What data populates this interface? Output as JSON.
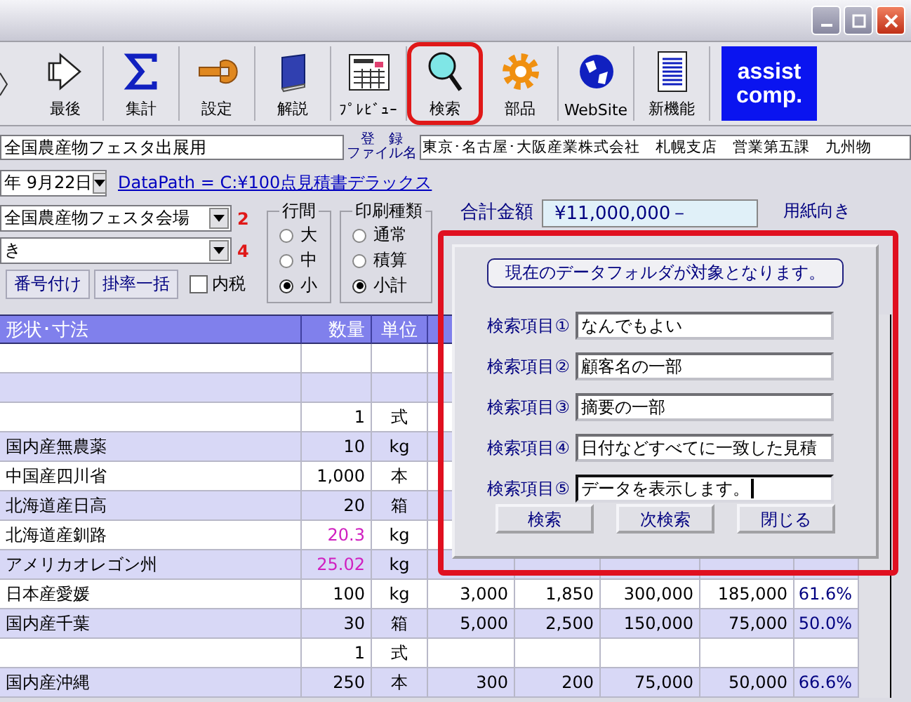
{
  "toolbar": {
    "items": [
      {
        "label": "最後",
        "highlighted": false
      },
      {
        "label": "集計",
        "highlighted": false
      },
      {
        "label": "設定",
        "highlighted": false
      },
      {
        "label": "解説",
        "highlighted": false
      },
      {
        "label": "ﾌﾟﾚﾋﾞｭｰ",
        "highlighted": false
      },
      {
        "label": "検索",
        "highlighted": true
      },
      {
        "label": "部品",
        "highlighted": false
      },
      {
        "label": "WebSite",
        "highlighted": false
      },
      {
        "label": "新機能",
        "highlighted": false
      }
    ],
    "logo": [
      "assist",
      "comp."
    ]
  },
  "form": {
    "title_value": "全国農産物フェスタ出展用",
    "file_label": [
      "登　録",
      "ファイル名"
    ],
    "file_value": "東京･名古屋･大阪産業株式会社　札幌支店　営業第五課　九州物",
    "date_value": "年  9月22日",
    "data_path_link": "DataPath = C:¥100点見積書デラックス",
    "combos": [
      {
        "value": "全国農産物フェスタ会場",
        "marker": "2"
      },
      {
        "value": "き",
        "marker": "4"
      }
    ],
    "buttons": [
      "番号付け",
      "掛率一括"
    ],
    "tax_checkbox": {
      "label": "内税",
      "checked": false
    },
    "groups": [
      {
        "title": "行間",
        "options": [
          {
            "label": "大",
            "selected": false
          },
          {
            "label": "中",
            "selected": false
          },
          {
            "label": "小",
            "selected": true
          }
        ]
      },
      {
        "title": "印刷種類",
        "options": [
          {
            "label": "通常",
            "selected": false
          },
          {
            "label": "積算",
            "selected": false
          },
          {
            "label": "小計",
            "selected": true
          }
        ]
      }
    ],
    "total_label": "合計金額",
    "total_value": "¥11,000,000－",
    "paper_label": "用紙向き"
  },
  "table": {
    "columns": [
      "形状･寸法",
      "数量",
      "単位"
    ],
    "rows": [
      {
        "name": "",
        "qty": "",
        "unit": "",
        "values": []
      },
      {
        "name": "",
        "qty": "",
        "unit": "",
        "values": []
      },
      {
        "name": "",
        "qty": "1",
        "unit": "式",
        "qty_highlight": false,
        "values": []
      },
      {
        "name": "国内産無農薬",
        "qty": "10",
        "unit": "kg",
        "qty_highlight": false,
        "values": []
      },
      {
        "name": "中国産四川省",
        "qty": "1,000",
        "unit": "本",
        "qty_highlight": false,
        "values": []
      },
      {
        "name": "北海道産日高",
        "qty": "20",
        "unit": "箱",
        "qty_highlight": false,
        "values": []
      },
      {
        "name": "北海道産釧路",
        "qty": "20.3",
        "unit": "kg",
        "qty_highlight": true,
        "values": []
      },
      {
        "name": "アメリカオレゴン州",
        "qty": "25.02",
        "unit": "kg",
        "qty_highlight": true,
        "values": []
      },
      {
        "name": "日本産愛媛",
        "qty": "100",
        "unit": "kg",
        "qty_highlight": false,
        "values": [
          "3,000",
          "1,850",
          "300,000",
          "185,000",
          "61.6%"
        ]
      },
      {
        "name": "国内産千葉",
        "qty": "30",
        "unit": "箱",
        "qty_highlight": false,
        "values": [
          "5,000",
          "2,500",
          "150,000",
          "75,000",
          "50.0%"
        ]
      },
      {
        "name": "",
        "qty": "1",
        "unit": "式",
        "qty_highlight": false,
        "values": []
      },
      {
        "name": "国内産沖縄",
        "qty": "250",
        "unit": "本",
        "qty_highlight": false,
        "values": [
          "300",
          "200",
          "75,000",
          "50,000",
          "66.6%"
        ]
      }
    ]
  },
  "search_dialog": {
    "highlighted": true,
    "notice": "現在のデータフォルダが対象となります。",
    "fields": [
      {
        "label": "検索項目①",
        "value": "なんでもよい",
        "focused": false
      },
      {
        "label": "検索項目②",
        "value": "顧客名の一部",
        "focused": false
      },
      {
        "label": "検索項目③",
        "value": "摘要の一部",
        "focused": false
      },
      {
        "label": "検索項目④",
        "value": "日付などすべてに一致した見積",
        "focused": false
      },
      {
        "label": "検索項目⑤",
        "value": "データを表示します。",
        "focused": true
      }
    ],
    "buttons": [
      "検索",
      "次検索",
      "閉じる"
    ]
  }
}
